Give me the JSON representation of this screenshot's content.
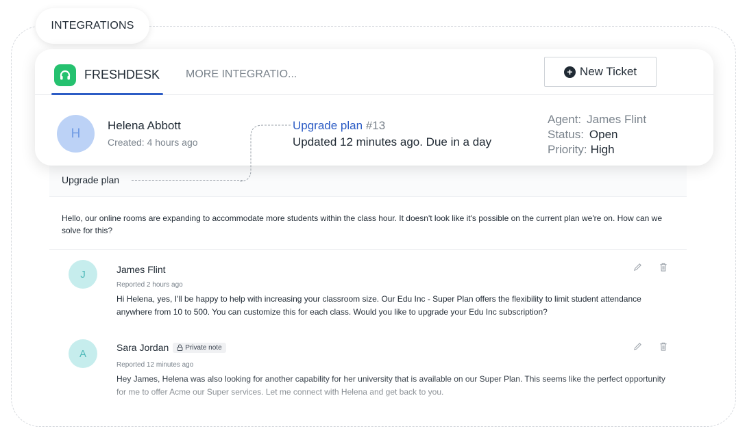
{
  "section": {
    "label": "INTEGRATIONS"
  },
  "tabs": {
    "active_label": "FRESHDESK",
    "more_label": "MORE INTEGRATIO..."
  },
  "new_ticket": {
    "label": "New Ticket"
  },
  "customer": {
    "initial": "H",
    "name": "Helena Abbott",
    "created": "Created: 4 hours ago"
  },
  "ticket": {
    "title": "Upgrade plan",
    "id": "#13",
    "updated": "Updated 12 minutes ago. Due in a day",
    "agent_label": "Agent:",
    "agent_value": "James Flint",
    "status_label": "Status:",
    "status_value": "Open",
    "priority_label": "Priority:",
    "priority_value": "High",
    "message": "Hello, our online rooms are expanding to accommodate more students within the class hour. It doesn't look like it's possible on the current plan we're on. How can we solve for this?"
  },
  "comments": [
    {
      "initial": "J",
      "name": "James Flint",
      "badge": "",
      "meta": "Reported 2 hours ago",
      "body": "Hi Helena, yes, I'll be happy to help with increasing your classroom size. Our Edu Inc - Super Plan offers the flexibility to limit student attendance anywhere from 10 to 500. You can customize this for each class. Would you like to upgrade your Edu Inc subscription?"
    },
    {
      "initial": "A",
      "name": "Sara Jordan",
      "badge": "Private note",
      "meta": "Reported 12 minutes ago",
      "body": "Hey James, Helena was also looking for another capability for her university that is available on our Super Plan. This seems like the perfect opportunity for me to offer Acme our Super services. Let me connect with Helena and get back to you."
    }
  ],
  "icons": {
    "logo": "freshdesk-headset-icon",
    "new_ticket": "plus-circle-icon",
    "edit": "pencil-icon",
    "delete": "trash-icon",
    "lock": "lock-icon"
  },
  "colors": {
    "accent": "#2c5cc5",
    "freshdesk_green": "#25c16f",
    "customer_avatar": "#bcd2f6",
    "comment_avatar": "#c6eded"
  }
}
